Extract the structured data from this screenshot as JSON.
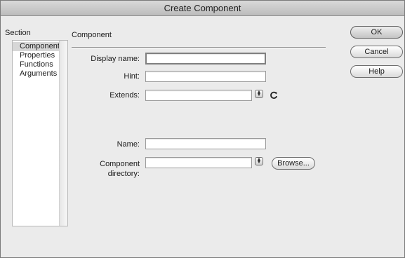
{
  "window": {
    "title": "Create Component"
  },
  "sections": {
    "label": "Section",
    "items": [
      {
        "label": "Component",
        "selected": true
      },
      {
        "label": "Properties",
        "selected": false
      },
      {
        "label": "Functions",
        "selected": false
      },
      {
        "label": "Arguments",
        "selected": false
      }
    ]
  },
  "panel": {
    "heading": "Component",
    "display_name": {
      "label": "Display name:",
      "value": ""
    },
    "hint": {
      "label": "Hint:",
      "value": ""
    },
    "extends": {
      "label": "Extends:",
      "value": "",
      "stepper_icon": "stepper-icon",
      "refresh_icon": "refresh-icon"
    },
    "name": {
      "label": "Name:",
      "value": ""
    },
    "component_directory": {
      "label": "Component directory:",
      "value": "",
      "stepper_icon": "stepper-icon",
      "browse_label": "Browse..."
    }
  },
  "buttons": {
    "ok": "OK",
    "cancel": "Cancel",
    "help": "Help"
  }
}
